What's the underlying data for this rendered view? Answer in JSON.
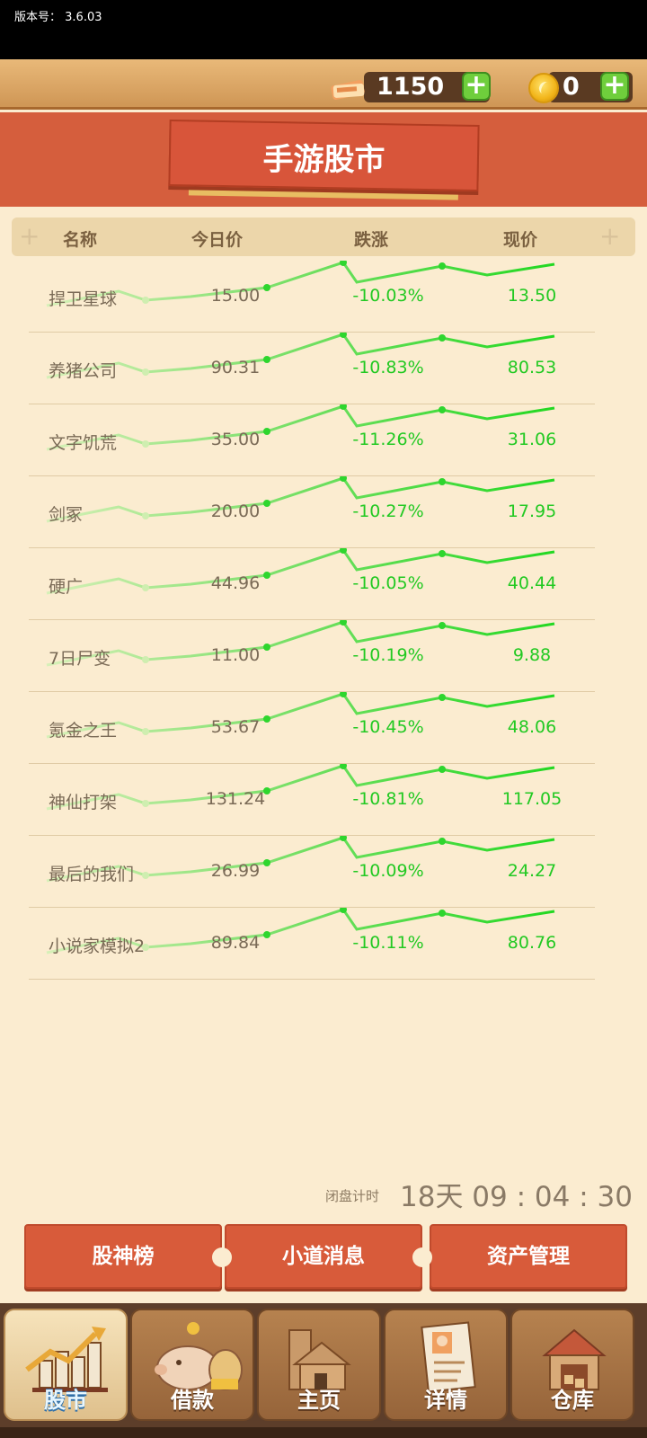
{
  "status": {
    "version_label": "版本号：",
    "version": "3.6.03"
  },
  "resources": {
    "tickets": "1150",
    "coins": "0",
    "plus": "+"
  },
  "title": "手游股市",
  "table": {
    "headers": {
      "name": "名称",
      "today_price": "今日价",
      "change": "跌涨",
      "current": "现价"
    },
    "rows": [
      {
        "name": "捍卫星球",
        "today_price": "15.00",
        "change": "-10.03%",
        "current": "13.50"
      },
      {
        "name": "养猪公司",
        "today_price": "90.31",
        "change": "-10.83%",
        "current": "80.53"
      },
      {
        "name": "文字饥荒",
        "today_price": "35.00",
        "change": "-11.26%",
        "current": "31.06"
      },
      {
        "name": "剑冢",
        "today_price": "20.00",
        "change": "-10.27%",
        "current": "17.95"
      },
      {
        "name": "硬广",
        "today_price": "44.96",
        "change": "-10.05%",
        "current": "40.44"
      },
      {
        "name": "7日尸变",
        "today_price": "11.00",
        "change": "-10.19%",
        "current": "9.88"
      },
      {
        "name": "氪金之王",
        "today_price": "53.67",
        "change": "-10.45%",
        "current": "48.06"
      },
      {
        "name": "神仙打架",
        "today_price": "131.24",
        "change": "-10.81%",
        "current": "117.05"
      },
      {
        "name": "最后的我们",
        "today_price": "26.99",
        "change": "-10.09%",
        "current": "24.27"
      },
      {
        "name": "小说家模拟2",
        "today_price": "89.84",
        "change": "-10.11%",
        "current": "80.76"
      }
    ]
  },
  "countdown": {
    "label": "闭盘计时",
    "value": "18天 09 : 04 : 30"
  },
  "actions": {
    "ranking": "股神榜",
    "news": "小道消息",
    "assets": "资产管理"
  },
  "nav": {
    "stocks": "股市",
    "loan": "借款",
    "home": "主页",
    "details": "详情",
    "warehouse": "仓库"
  },
  "colors": {
    "up_green": "#22c922",
    "accent_red": "#d85b3a",
    "background": "#fbecd0"
  }
}
